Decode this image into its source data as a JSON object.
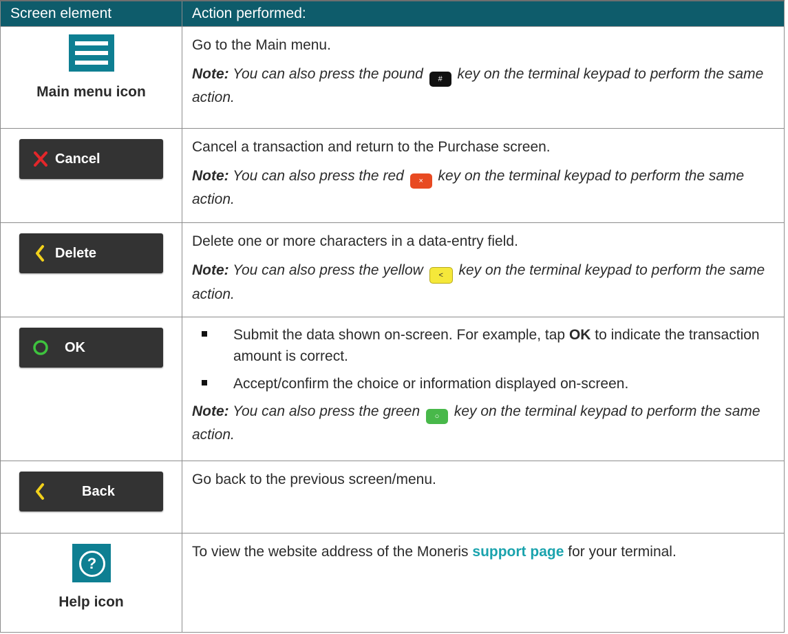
{
  "header": {
    "col1": "Screen element",
    "col2": "Action performed:"
  },
  "rows": [
    {
      "element_label": "Main menu icon",
      "action": "Go to the Main menu.",
      "note_label": "Note:",
      "note_before": "You can also press the pound",
      "note_key": "#",
      "note_after": "key on the terminal keypad to perform the same action."
    },
    {
      "button_label": "Cancel",
      "action": "Cancel a transaction and return to the Purchase screen.",
      "note_label": "Note:",
      "note_before": "You can also press the red",
      "note_key": "×",
      "note_after": "key on the terminal keypad to perform the same action."
    },
    {
      "button_label": "Delete",
      "action": "Delete one or more characters in a data-entry field.",
      "note_label": "Note:",
      "note_before": "You can also press the yellow",
      "note_key": "<",
      "note_after": "key on the terminal keypad to perform the same action."
    },
    {
      "button_label": "OK",
      "bullet1_a": "Submit the data shown on-screen. For example, tap",
      "bullet1_bold": "OK",
      "bullet1_b": "to indicate the transaction amount is correct.",
      "bullet2": "Accept/confirm the choice or information displayed on-screen.",
      "note_label": "Note:",
      "note_before": "You can also press the green",
      "note_key": "○",
      "note_after": "key on the terminal keypad to perform the same action."
    },
    {
      "button_label": "Back",
      "action": "Go back to the previous screen/menu."
    },
    {
      "element_label": "Help icon",
      "action_before": "To view the website address of the Moneris",
      "link": "support page",
      "action_after": "for your terminal.",
      "icon_glyph": "?"
    }
  ],
  "colors": {
    "header_bg": "#0e5c6b",
    "icon_teal": "#0e7f92",
    "button_bg": "#333333",
    "cancel_x": "#e3262a",
    "delete_chevron": "#f2d11b",
    "ok_circle": "#3ec33e",
    "back_chevron": "#f2d11b",
    "link": "#1aa3ad"
  },
  "icons": [
    "hamburger-menu-icon",
    "close-x-icon",
    "chevron-left-icon",
    "circle-icon",
    "help-question-icon"
  ]
}
